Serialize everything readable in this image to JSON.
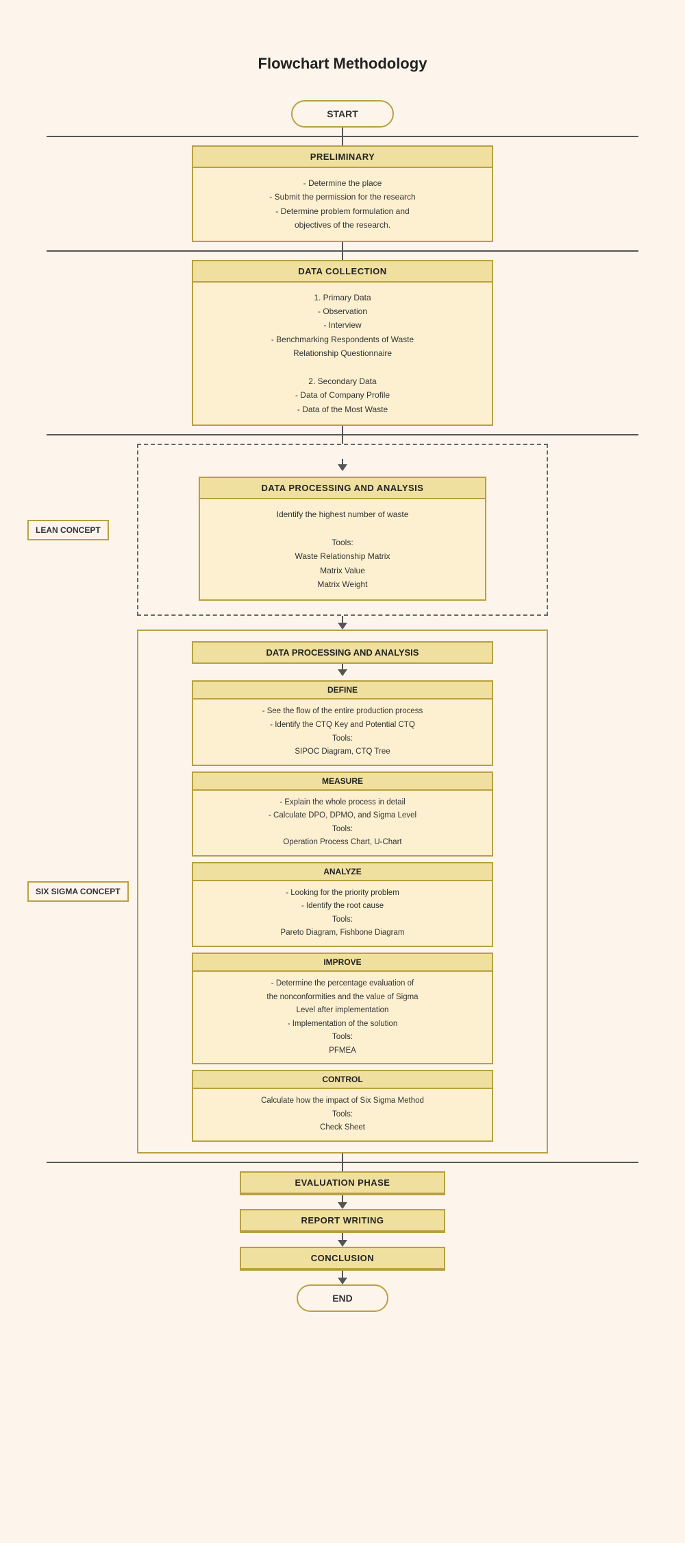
{
  "title": "Flowchart Methodology",
  "start_label": "START",
  "end_label": "END",
  "preliminary": {
    "header": "PRELIMINARY",
    "content": "- Determine the place\n- Submit the permission for the research\n- Determine problem formulation and\nobjectives of the research."
  },
  "data_collection": {
    "header": "DATA COLLECTION",
    "content": "1. Primary Data\n- Observation\n- Interview\n- Benchmarking Respondents of Waste\nRelationship Questionnaire\n\n2. Secondary Data\n- Data of Company Profile\n- Data of the Most Waste"
  },
  "lean_concept_label": "LEAN CONCEPT",
  "lean_processing": {
    "header": "DATA PROCESSING AND ANALYSIS",
    "content": "Identify the highest number of waste\n\nTools:\nWaste Relationship Matrix\nMatrix Value\nMatrix Weight"
  },
  "six_sigma_label": "SIX SIGMA CONCEPT",
  "sigma_processing_header": "DATA PROCESSING AND ANALYSIS",
  "define": {
    "header": "DEFINE",
    "content": "- See the flow of the entire production process\n- Identify the CTQ Key and Potential CTQ\nTools:\nSIPOC Diagram, CTQ Tree"
  },
  "measure": {
    "header": "MEASURE",
    "content": "- Explain the whole process in detail\n- Calculate DPO, DPMO, and Sigma Level\nTools:\nOperation Process Chart, U-Chart"
  },
  "analyze": {
    "header": "ANALYZE",
    "content": "- Looking for the priority problem\n- Identify the root cause\nTools:\nPareto Diagram, Fishbone Diagram"
  },
  "improve": {
    "header": "IMPROVE",
    "content": "- Determine the percentage evaluation of\nthe nonconformities and the value of Sigma\nLevel after implementation\n- Implementation of the solution\nTools:\nPFMEA"
  },
  "control": {
    "header": "CONTROL",
    "content": "Calculate how the impact of Six Sigma Method\nTools:\nCheck Sheet"
  },
  "evaluation": {
    "header": "EVALUATION PHASE"
  },
  "report": {
    "header": "REPORT WRITING"
  },
  "conclusion": {
    "header": "CONCLUSION"
  }
}
